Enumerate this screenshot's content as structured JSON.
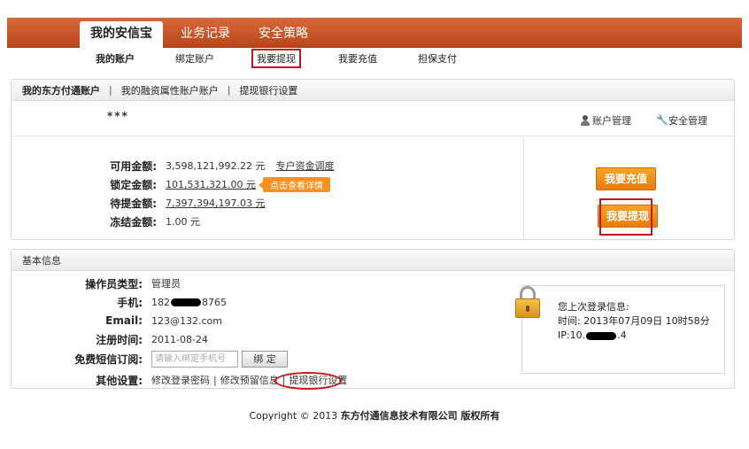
{
  "topnav": {
    "tabs": [
      "我的安信宝",
      "业务记录",
      "安全策略"
    ]
  },
  "subnav": {
    "items": [
      "我的账户",
      "绑定账户",
      "我要提现",
      "我要充值",
      "担保支付"
    ]
  },
  "account_tabs": {
    "tab1": "我的东方付通账户",
    "sep": "|",
    "tab2": "我的融资属性账户账户",
    "tab3": "提现银行设置"
  },
  "account": {
    "masked_name": "***",
    "manage_label": "账户管理",
    "security_label": "安全管理"
  },
  "balances": {
    "available_label": "可用金额:",
    "available_value": "3,598,121,992.22 元",
    "available_link": "专户资金调度",
    "locked_label": "锁定金额:",
    "locked_value": "101,531,321.00 元",
    "locked_tip": "点击查看详情",
    "pending_label": "待提金额:",
    "pending_value": "7,397,394,197.03 元",
    "frozen_label": "冻结金额:",
    "frozen_value": "1.00 元"
  },
  "buttons": {
    "recharge": "我要充值",
    "withdraw": "我要提现"
  },
  "basic": {
    "header": "基本信息",
    "role_label": "操作员类型:",
    "role_value": "管理员",
    "phone_label": "手机:",
    "phone_prefix": "182",
    "phone_suffix": "8765",
    "email_label": "Email:",
    "email_value": "123@132.com",
    "reg_label": "注册时间:",
    "reg_value": "2011-08-24",
    "sms_label": "免费短信订阅:",
    "sms_placeholder": "请输入绑定手机号",
    "sms_button": "绑 定",
    "other_label": "其他设置:",
    "other_link1": "修改登录密码",
    "other_link2": "修改预留信息",
    "other_link3": "提现银行设置",
    "bar": "|"
  },
  "login_info": {
    "title": "您上次登录信息:",
    "time": "时间: 2013年07月09日  10时58分",
    "ip_prefix": "IP:10.",
    "ip_suffix": ".4"
  },
  "footer": {
    "prefix": "Copyright © 2013 ",
    "company": "东方付通信息技术有限公司  版权所有"
  }
}
